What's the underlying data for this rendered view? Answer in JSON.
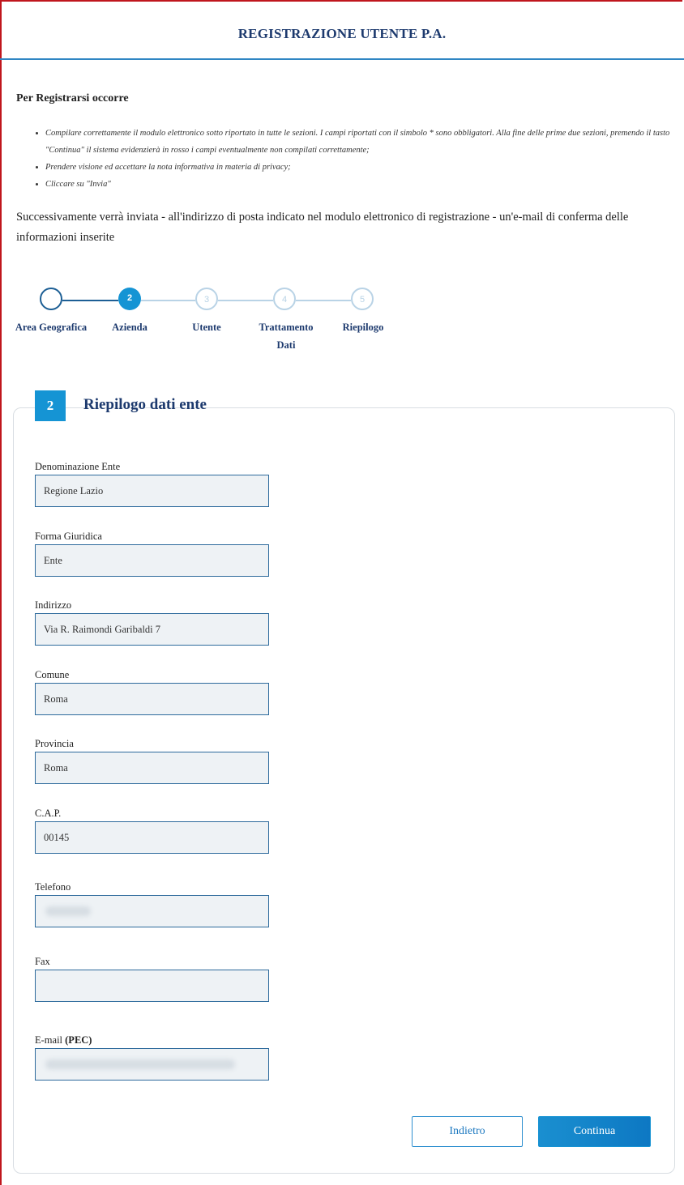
{
  "page_title": "REGISTRAZIONE UTENTE P.A.",
  "intro": {
    "heading": "Per Registrarsi occorre",
    "instructions": [
      "Compilare correttamente il modulo elettronico sotto riportato in tutte le sezioni. I campi riportati con il simbolo * sono obbligatori. Alla fine delle prime due sezioni, premendo il tasto \"Continua\" il sistema evidenzierà in rosso i campi eventualmente non compilati correttamente;",
      "Prendere visione ed accettare la nota informativa in materia di privacy;",
      "Cliccare su \"Invia\""
    ],
    "note": "Successivamente verrà inviata - all'indirizzo di posta indicato nel modulo elettronico di registrazione - un'e-mail di conferma delle informazioni inserite"
  },
  "stepper": {
    "current": 2,
    "steps": [
      {
        "number": "",
        "label": "Area Geografica"
      },
      {
        "number": "2",
        "label": "Azienda"
      },
      {
        "number": "3",
        "label": "Utente"
      },
      {
        "number": "4",
        "label": "Trattamento Dati"
      },
      {
        "number": "5",
        "label": "Riepilogo"
      }
    ],
    "colors": {
      "done": "#1d5f95",
      "active": "#1594d4",
      "todo": "#b9d3e6"
    }
  },
  "section": {
    "number": "2",
    "title": "Riepilogo dati ente",
    "fields": [
      {
        "label": "Denominazione Ente",
        "value": "Regione Lazio"
      },
      {
        "label": "Forma Giuridica",
        "value": "Ente"
      },
      {
        "label": "Indirizzo",
        "value": "Via R. Raimondi Garibaldi 7"
      },
      {
        "label": "Comune",
        "value": "Roma"
      },
      {
        "label": "Provincia",
        "value": "Roma"
      },
      {
        "label": "C.A.P.",
        "value": "00145"
      },
      {
        "label": "Telefono",
        "value": ""
      },
      {
        "label": "Fax",
        "value": ""
      },
      {
        "label_main": "E-mail",
        "label_bold": "(PEC)",
        "value": ""
      }
    ]
  },
  "buttons": {
    "back": "Indietro",
    "next": "Continua"
  }
}
